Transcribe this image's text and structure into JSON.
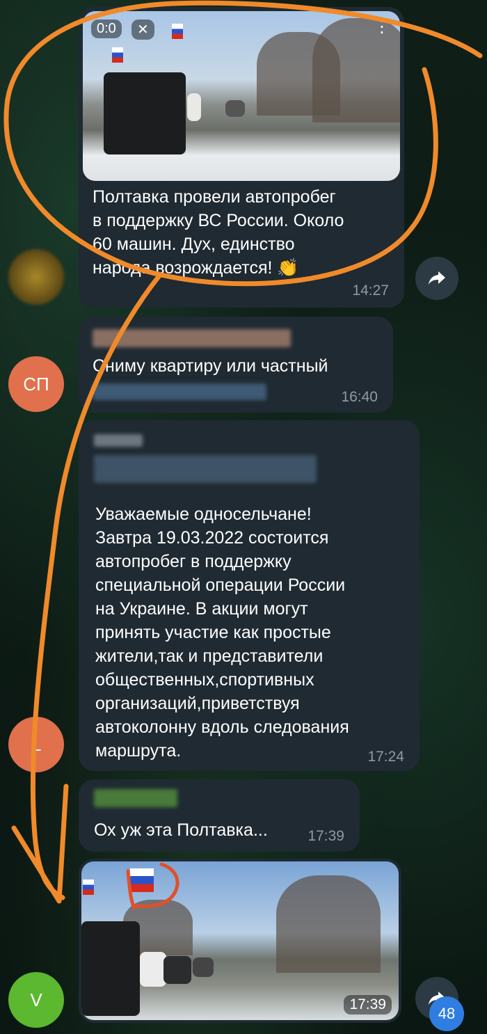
{
  "messages": [
    {
      "text": "Полтавка провели автопробег\nв поддержку ВС России. Около\n60 машин. Дух, единство\nнарода возрождается! 👏",
      "time": "14:27",
      "video_time": "0:0"
    },
    {
      "text": "Сниму квартиру или частный",
      "time": "16:40"
    },
    {
      "text": "Уважаемые односельчане!\nЗавтра 19.03.2022  состоится\nавтопробег в поддержку\nспециальной  операции России\nна Украине. В акции могут\nпринять участие как простые\nжители,так и представители\nобщественных,спортивных\nорганизаций,приветствуя\nавтоколонну вдоль следования\nмаршрута.",
      "time": "17:24"
    },
    {
      "text": "Ох уж эта Полтавка...",
      "time": "17:39"
    },
    {
      "time": "17:39"
    }
  ],
  "avatars": {
    "sp": "СП",
    "l": "L",
    "v": "V"
  },
  "unread_badge": "48",
  "colors": {
    "bubble": "#1f2a32",
    "avatar_sp": "#e0714c",
    "avatar_l": "#e0714c",
    "avatar_v": "#5cb82e",
    "annotation": "#f08a2a"
  }
}
